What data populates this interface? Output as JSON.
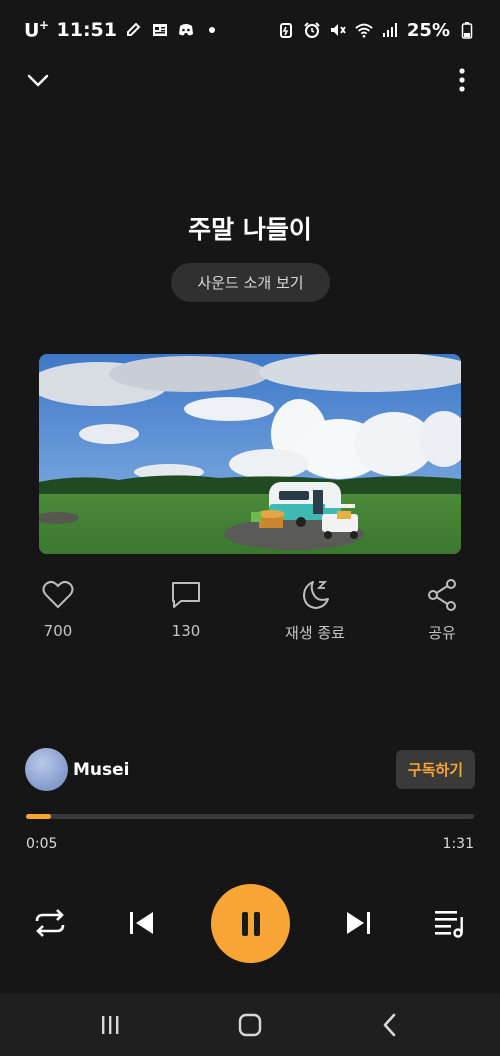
{
  "status_bar": {
    "carrier": "U",
    "carrier_sup": "+",
    "time": "11:51",
    "battery": "25%",
    "icons": [
      "pencil-icon",
      "news-icon",
      "discord-icon",
      "dot-icon",
      "battery-saver-icon",
      "alarm-icon",
      "mute-icon",
      "wifi-icon",
      "signal-icon",
      "battery-icon"
    ]
  },
  "player": {
    "title": "주말 나들이",
    "intro_button": "사운드 소개 보기"
  },
  "actions": {
    "like_count": "700",
    "comment_count": "130",
    "sleep_timer_label": "재생 종료",
    "share_label": "공유"
  },
  "channel": {
    "name": "Musei",
    "subscribe_label": "구독하기"
  },
  "playback": {
    "current_time": "0:05",
    "total_time": "1:31",
    "progress": 0.055
  },
  "colors": {
    "accent": "#f7a534",
    "background": "#161616"
  }
}
